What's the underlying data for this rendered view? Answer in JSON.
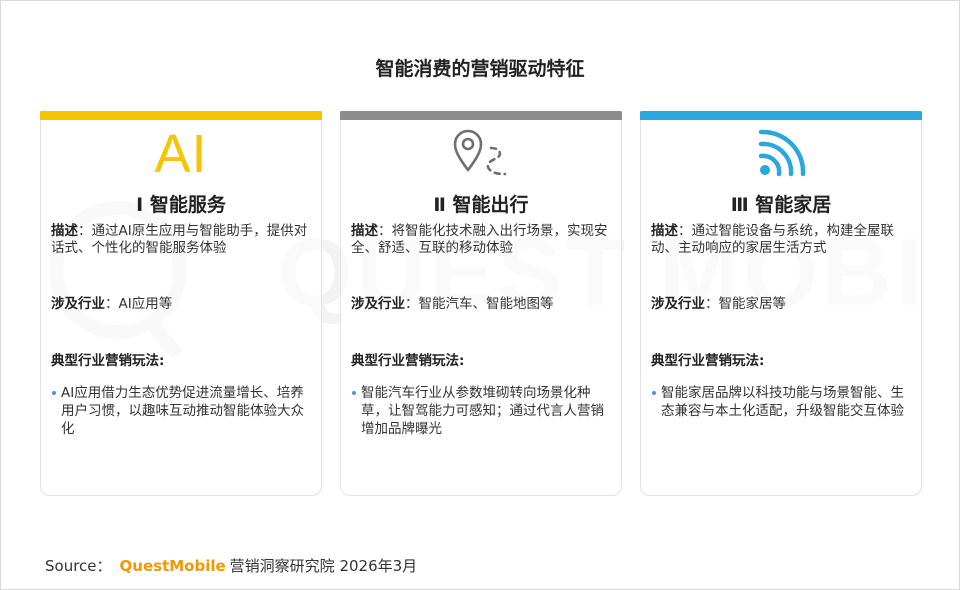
{
  "title": "智能消费的营销驱动特征",
  "watermark": "QUEST MOBILE",
  "colors": {
    "yellow": "#f6c400",
    "gray": "#8c8c8c",
    "blue": "#2aa7dc",
    "brand": "#f29700"
  },
  "cards": [
    {
      "icon": "ai-text-icon",
      "icon_text": "AI",
      "heading": "Ⅰ 智能服务",
      "desc_label": "描述",
      "desc_text": "：通过AI原生应用与智能助手，提供对话式、个性化的智能服务体验",
      "industry_label": "涉及行业",
      "industry_text": "：AI应用等",
      "play_title": "典型行业营销玩法:",
      "bullet": "AI应用借力生态优势促进流量增长、培养用户习惯，以趣味互动推动智能体验大众化"
    },
    {
      "icon": "location-route-icon",
      "heading": "Ⅱ 智能出行",
      "desc_label": "描述",
      "desc_text": "：将智能化技术融入出行场景，实现安全、舒适、互联的移动体验",
      "industry_label": "涉及行业",
      "industry_text": "：智能汽车、智能地图等",
      "play_title": "典型行业营销玩法:",
      "bullet": "智能汽车行业从参数堆砌转向场景化种草，让智驾能力可感知；通过代言人营销增加品牌曝光"
    },
    {
      "icon": "wifi-signal-icon",
      "heading": "Ⅲ 智能家居",
      "desc_label": "描述",
      "desc_text": "：通过智能设备与系统，构建全屋联动、主动响应的家居生活方式",
      "industry_label": "涉及行业",
      "industry_text": "：智能家居等",
      "play_title": "典型行业营销玩法:",
      "bullet": "智能家居品牌以科技功能与场景智能、生态兼容与本土化适配，升级智能交互体验"
    }
  ],
  "source": {
    "label": "Source：",
    "brand": "QuestMobile",
    "text": "营销洞察研究院 2026年3月"
  }
}
